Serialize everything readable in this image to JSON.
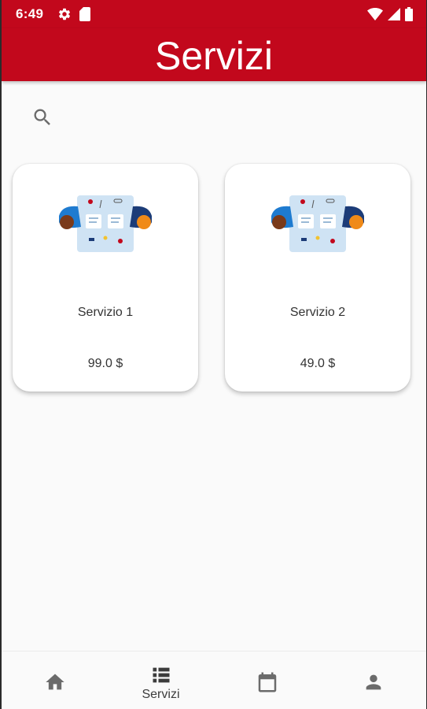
{
  "status_bar": {
    "time": "6:49",
    "icons": [
      "settings-icon",
      "sim-card-icon",
      "wifi-icon",
      "signal-icon",
      "battery-icon"
    ],
    "background": "#c2081c"
  },
  "app_bar": {
    "title": "Servizi",
    "background": "#c2081c"
  },
  "search": {
    "icon": "search-icon"
  },
  "services": [
    {
      "title": "Servizio 1",
      "price": "99.0 $",
      "image": "meeting-illustration"
    },
    {
      "title": "Servizio 2",
      "price": "49.0 $",
      "image": "meeting-illustration"
    }
  ],
  "bottom_nav": {
    "items": [
      {
        "icon": "home-icon",
        "label": "",
        "active": false
      },
      {
        "icon": "list-icon",
        "label": "Servizi",
        "active": true
      },
      {
        "icon": "calendar-icon",
        "label": "",
        "active": false
      },
      {
        "icon": "person-icon",
        "label": "",
        "active": false
      }
    ]
  },
  "colors": {
    "primary": "#c2081c",
    "background": "#fafafa",
    "card": "#ffffff",
    "icon": "#6b6b6b"
  }
}
